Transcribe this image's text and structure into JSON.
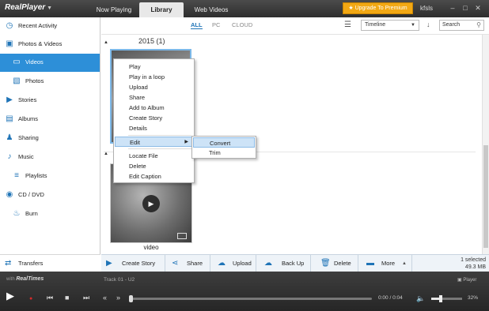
{
  "titlebar": {
    "logo": "RealPlayer",
    "tabs": [
      "Now Playing",
      "Library",
      "Web Videos"
    ],
    "upgrade": "★ Upgrade To Premium",
    "user": "kfsls"
  },
  "sidebar": {
    "items": [
      {
        "label": "Recent Activity",
        "icon": "recent-activity-icon"
      },
      {
        "label": "Photos & Videos",
        "icon": "photos-videos-icon"
      },
      {
        "label": "Videos",
        "icon": "videos-icon"
      },
      {
        "label": "Photos",
        "icon": "photos-icon"
      },
      {
        "label": "Stories",
        "icon": "stories-icon"
      },
      {
        "label": "Albums",
        "icon": "albums-icon"
      },
      {
        "label": "Sharing",
        "icon": "sharing-icon"
      },
      {
        "label": "Music",
        "icon": "music-icon"
      },
      {
        "label": "Playlists",
        "icon": "playlists-icon"
      },
      {
        "label": "CD / DVD",
        "icon": "cd-dvd-icon"
      },
      {
        "label": "Burn",
        "icon": "burn-icon"
      }
    ],
    "transfers": "Transfers"
  },
  "filters": {
    "all": "ALL",
    "pc": "PC",
    "cloud": "CLOUD"
  },
  "view": {
    "timeline": "Timeline",
    "search_placeholder": "Search"
  },
  "content": {
    "year": "2015 (1)",
    "video_label": "video"
  },
  "context_menu": {
    "items": [
      "Play",
      "Play in a loop",
      "Upload",
      "Share",
      "Add to Album",
      "Create Story",
      "Details",
      "Edit",
      "Locate File",
      "Delete",
      "Edit Caption"
    ],
    "submenu": [
      "Convert",
      "Trim"
    ]
  },
  "actions": {
    "create_story": "Create Story",
    "share": "Share",
    "upload": "Upload",
    "back_up": "Back Up",
    "delete": "Delete",
    "more": "More",
    "selected": "1 selected",
    "size": "49.3 MB"
  },
  "player": {
    "with_label": "with",
    "brand": "RealTimes",
    "track": "Track 01 - U2",
    "mode": "Player",
    "time": "0:00 / 0:04",
    "volume": "32%",
    "volume_level": 0.32,
    "progress": 0
  },
  "colors": {
    "accent": "#2d8fd8",
    "upgrade": "#f2a814",
    "highlight": "#cde3f7"
  }
}
